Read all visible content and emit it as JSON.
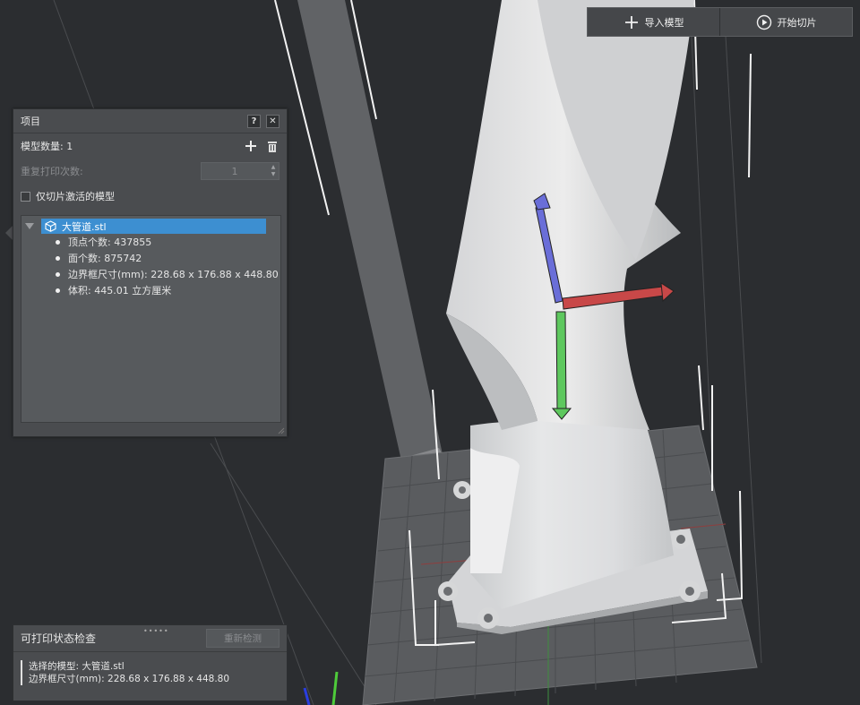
{
  "toolbar": {
    "import_label": "导入模型",
    "import_icon": "plus-icon",
    "slice_label": "开始切片",
    "slice_icon": "play-circle-icon"
  },
  "project_panel": {
    "title": "项目",
    "help_glyph": "?",
    "close_glyph": "✕",
    "model_count_label": "模型数量: 1",
    "repeat_label": "重复打印次数:",
    "repeat_value": "1",
    "slice_active_only_label": "仅切片激活的模型",
    "slice_active_only_checked": false,
    "tree": {
      "file_name": "大管道.stl",
      "items": [
        {
          "text": "顶点个数: 437855"
        },
        {
          "text": "面个数: 875742"
        },
        {
          "text": "边界框尺寸(mm): 228.68 x 176.88 x 448.80"
        },
        {
          "text": "体积: 445.01 立方厘米"
        }
      ]
    }
  },
  "print_check": {
    "title": "可打印状态检查",
    "grip": "•••••",
    "recheck_label": "重新检测",
    "selected_model": "选择的模型: 大管道.stl",
    "bbox": "边界框尺寸(mm): 228.68 x 176.88 x 448.80"
  },
  "colors": {
    "background": "#2b2d30",
    "panel": "#4a4c4f",
    "selection": "#3d8fd1",
    "gizmo_x": "#c84848",
    "gizmo_y": "#5ec85e",
    "gizmo_z": "#6a6ed8"
  }
}
